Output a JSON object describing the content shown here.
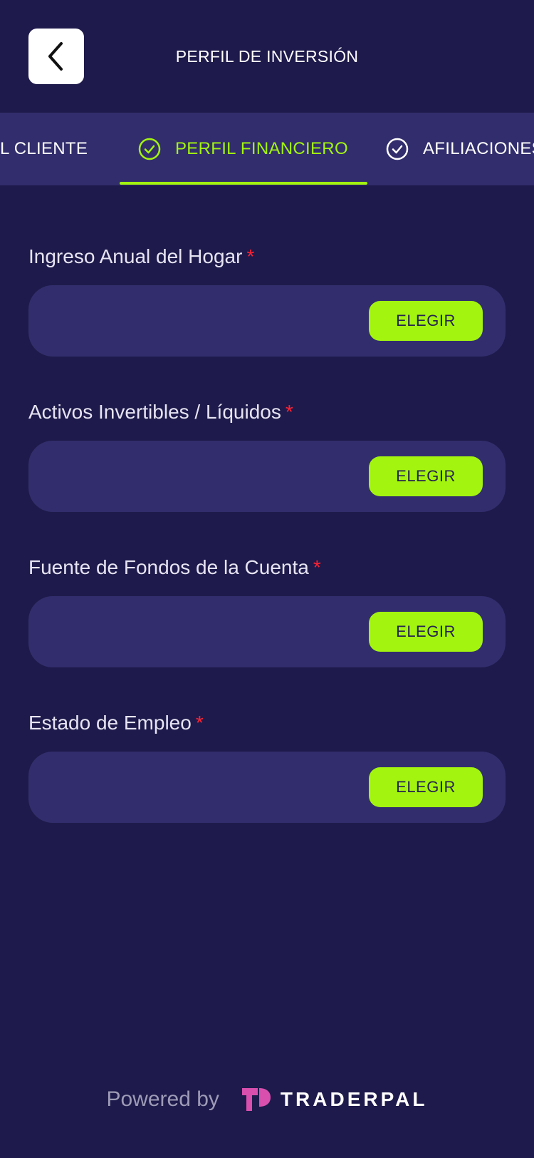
{
  "header": {
    "title": "PERFIL DE INVERSIÓN",
    "back_icon": "chevron-left-icon"
  },
  "tabs": [
    {
      "label": "L CLIENTE",
      "state": "partial"
    },
    {
      "label": "PERFIL FINANCIERO",
      "state": "active",
      "icon": "check-circle-icon"
    },
    {
      "label": "AFILIACIONES",
      "state": "inactive",
      "icon": "check-circle-icon"
    }
  ],
  "fields": [
    {
      "label": "Ingreso Anual del Hogar",
      "required_mark": "*",
      "value": "",
      "button": "ELEGIR"
    },
    {
      "label": "Activos Invertibles / Líquidos",
      "required_mark": "*",
      "value": "",
      "button": "ELEGIR"
    },
    {
      "label": "Fuente de Fondos de la Cuenta",
      "required_mark": "*",
      "value": "",
      "button": "ELEGIR"
    },
    {
      "label": "Estado de Empleo",
      "required_mark": "*",
      "value": "",
      "button": "ELEGIR"
    }
  ],
  "footer": {
    "powered_by": "Powered by",
    "brand": "TRADERPAL"
  },
  "colors": {
    "background": "#1e1a4b",
    "surface": "#322e6d",
    "accent": "#a3f50f",
    "required": "#ff2233",
    "brand_logo": "#d94fae"
  }
}
